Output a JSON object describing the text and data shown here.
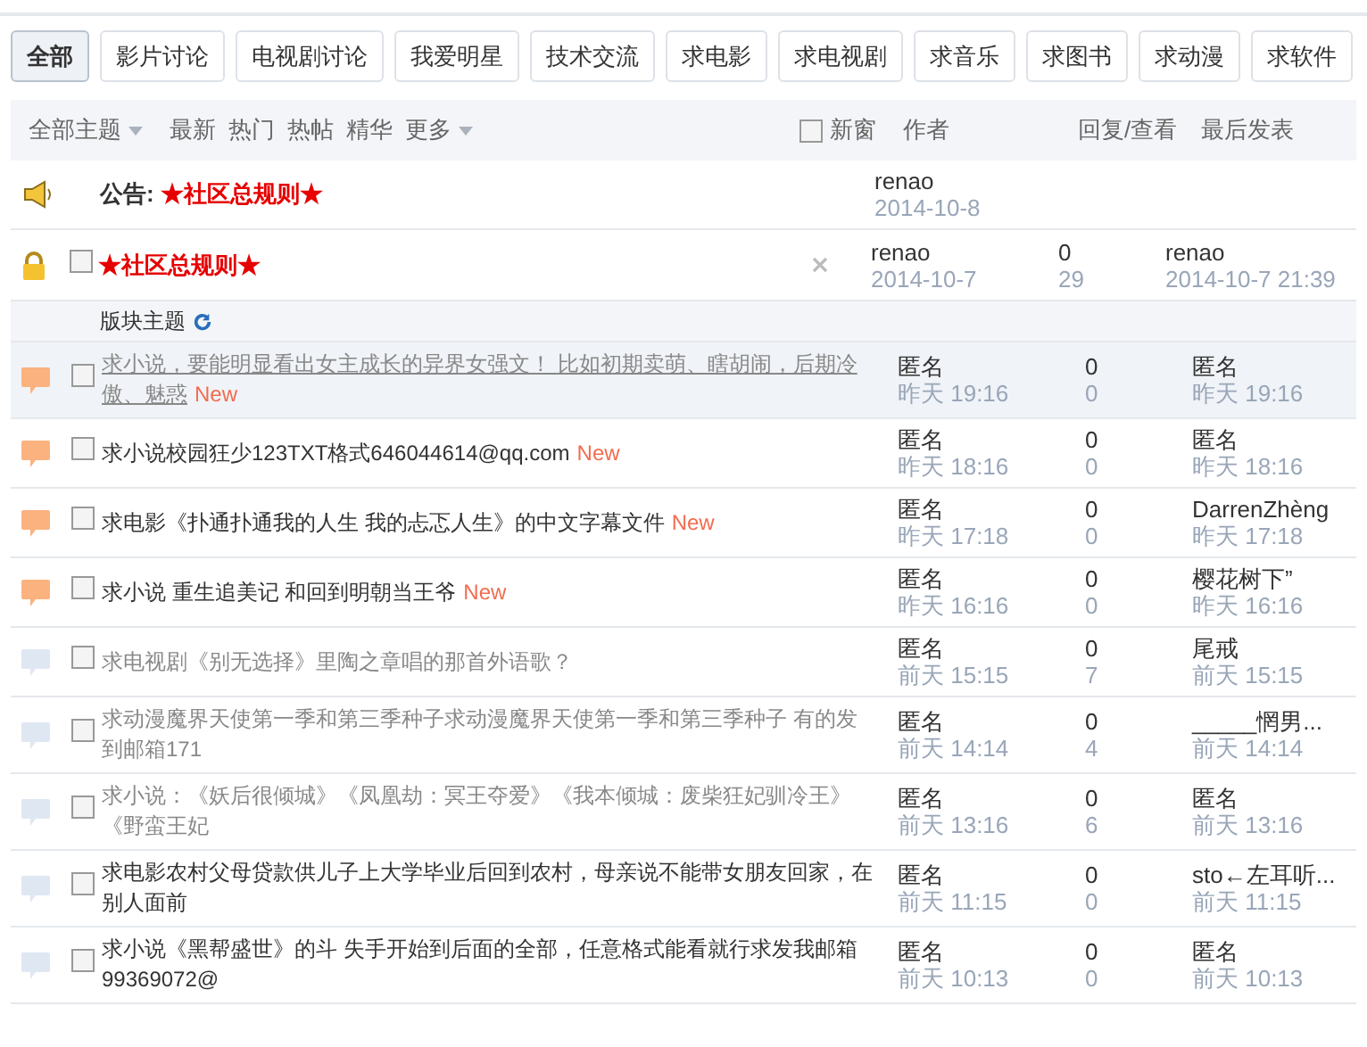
{
  "tabs": [
    {
      "label": "全部",
      "selected": true
    },
    {
      "label": "影片讨论",
      "selected": false
    },
    {
      "label": "电视剧讨论",
      "selected": false
    },
    {
      "label": "我爱明星",
      "selected": false
    },
    {
      "label": "技术交流",
      "selected": false
    },
    {
      "label": "求电影",
      "selected": false
    },
    {
      "label": "求电视剧",
      "selected": false
    },
    {
      "label": "求音乐",
      "selected": false
    },
    {
      "label": "求图书",
      "selected": false
    },
    {
      "label": "求动漫",
      "selected": false
    },
    {
      "label": "求软件",
      "selected": false
    }
  ],
  "filter_bar": {
    "all_topics": "全部主题",
    "filters": [
      "最新",
      "热门",
      "热帖",
      "精华"
    ],
    "more": "更多",
    "new_window": {
      "label": "新窗",
      "checked": false
    },
    "author": "作者",
    "replies_views": "回复/查看",
    "last_post": "最后发表"
  },
  "notice": {
    "prefix": "公告:",
    "title": "★社区总规则★",
    "author": "renao",
    "date": "2014-10-8"
  },
  "pinned": {
    "title": "★社区总规则★",
    "checked": false,
    "author": "renao",
    "date": "2014-10-7",
    "replies": "0",
    "views": "29",
    "last_author": "renao",
    "last_time": "2014-10-7 21:39"
  },
  "section": {
    "title": "版块主题"
  },
  "threads": [
    {
      "kind": "new",
      "title": "求小说，要能明显看出女主成长的异界女强文！ 比如初期卖萌、瞎胡闹，后期冷傲、魅惑",
      "badge": "New",
      "visited": true,
      "highlighted": true,
      "checked": false,
      "author": "匿名",
      "time": "昨天 19:16",
      "replies": "0",
      "views": "0",
      "last_author": "匿名",
      "last_time": "昨天 19:16"
    },
    {
      "kind": "new",
      "title": "求小说校园狂少123TXT格式646044614@qq.com",
      "badge": "New",
      "visited": false,
      "highlighted": false,
      "checked": false,
      "author": "匿名",
      "time": "昨天 18:16",
      "replies": "0",
      "views": "0",
      "last_author": "匿名",
      "last_time": "昨天 18:16"
    },
    {
      "kind": "new",
      "title": "求电影《扑通扑通我的人生 我的忐忑人生》的中文字幕文件",
      "badge": "New",
      "visited": false,
      "highlighted": false,
      "checked": false,
      "author": "匿名",
      "time": "昨天 17:18",
      "replies": "0",
      "views": "0",
      "last_author": "DarrenZhèng",
      "last_time": "昨天 17:18"
    },
    {
      "kind": "new",
      "title": "求小说 重生追美记 和回到明朝当王爷",
      "badge": "New",
      "visited": false,
      "highlighted": false,
      "checked": false,
      "author": "匿名",
      "time": "昨天 16:16",
      "replies": "0",
      "views": "0",
      "last_author": "樱花树下”",
      "last_time": "昨天 16:16"
    },
    {
      "kind": "normal",
      "title": "求电视剧《别无选择》里陶之章唱的那首外语歌？",
      "visited": true,
      "highlighted": false,
      "checked": false,
      "author": "匿名",
      "time": "前天 15:15",
      "replies": "0",
      "views": "7",
      "last_author": "尾戒",
      "last_time": "前天 15:15"
    },
    {
      "kind": "normal",
      "title": "求动漫魔界天使第一季和第三季种子求动漫魔界天使第一季和第三季种子 有的发到邮箱171",
      "visited": true,
      "highlighted": false,
      "checked": false,
      "author": "匿名",
      "time": "前天 14:14",
      "replies": "0",
      "views": "4",
      "last_author": "_____惘男...",
      "last_time": "前天 14:14"
    },
    {
      "kind": "normal",
      "title": "求小说：《妖后很倾城》《凤凰劫：冥王夺爱》《我本倾城：废柴狂妃驯冷王》《野蛮王妃",
      "visited": true,
      "highlighted": false,
      "checked": false,
      "author": "匿名",
      "time": "前天 13:16",
      "replies": "0",
      "views": "6",
      "last_author": "匿名",
      "last_time": "前天 13:16"
    },
    {
      "kind": "normal",
      "title": "求电影农村父母贷款供儿子上大学毕业后回到农村，母亲说不能带女朋友回家，在别人面前",
      "visited": false,
      "highlighted": false,
      "checked": false,
      "author": "匿名",
      "time": "前天 11:15",
      "replies": "0",
      "views": "0",
      "last_author": "sto←左耳听...",
      "last_time": "前天 11:15"
    },
    {
      "kind": "normal",
      "title": "求小说《黑帮盛世》的斗 失手开始到后面的全部，任意格式能看就行求发我邮箱99369072@",
      "visited": false,
      "highlighted": false,
      "checked": false,
      "author": "匿名",
      "time": "前天 10:13",
      "replies": "0",
      "views": "0",
      "last_author": "匿名",
      "last_time": "前天 10:13"
    }
  ]
}
